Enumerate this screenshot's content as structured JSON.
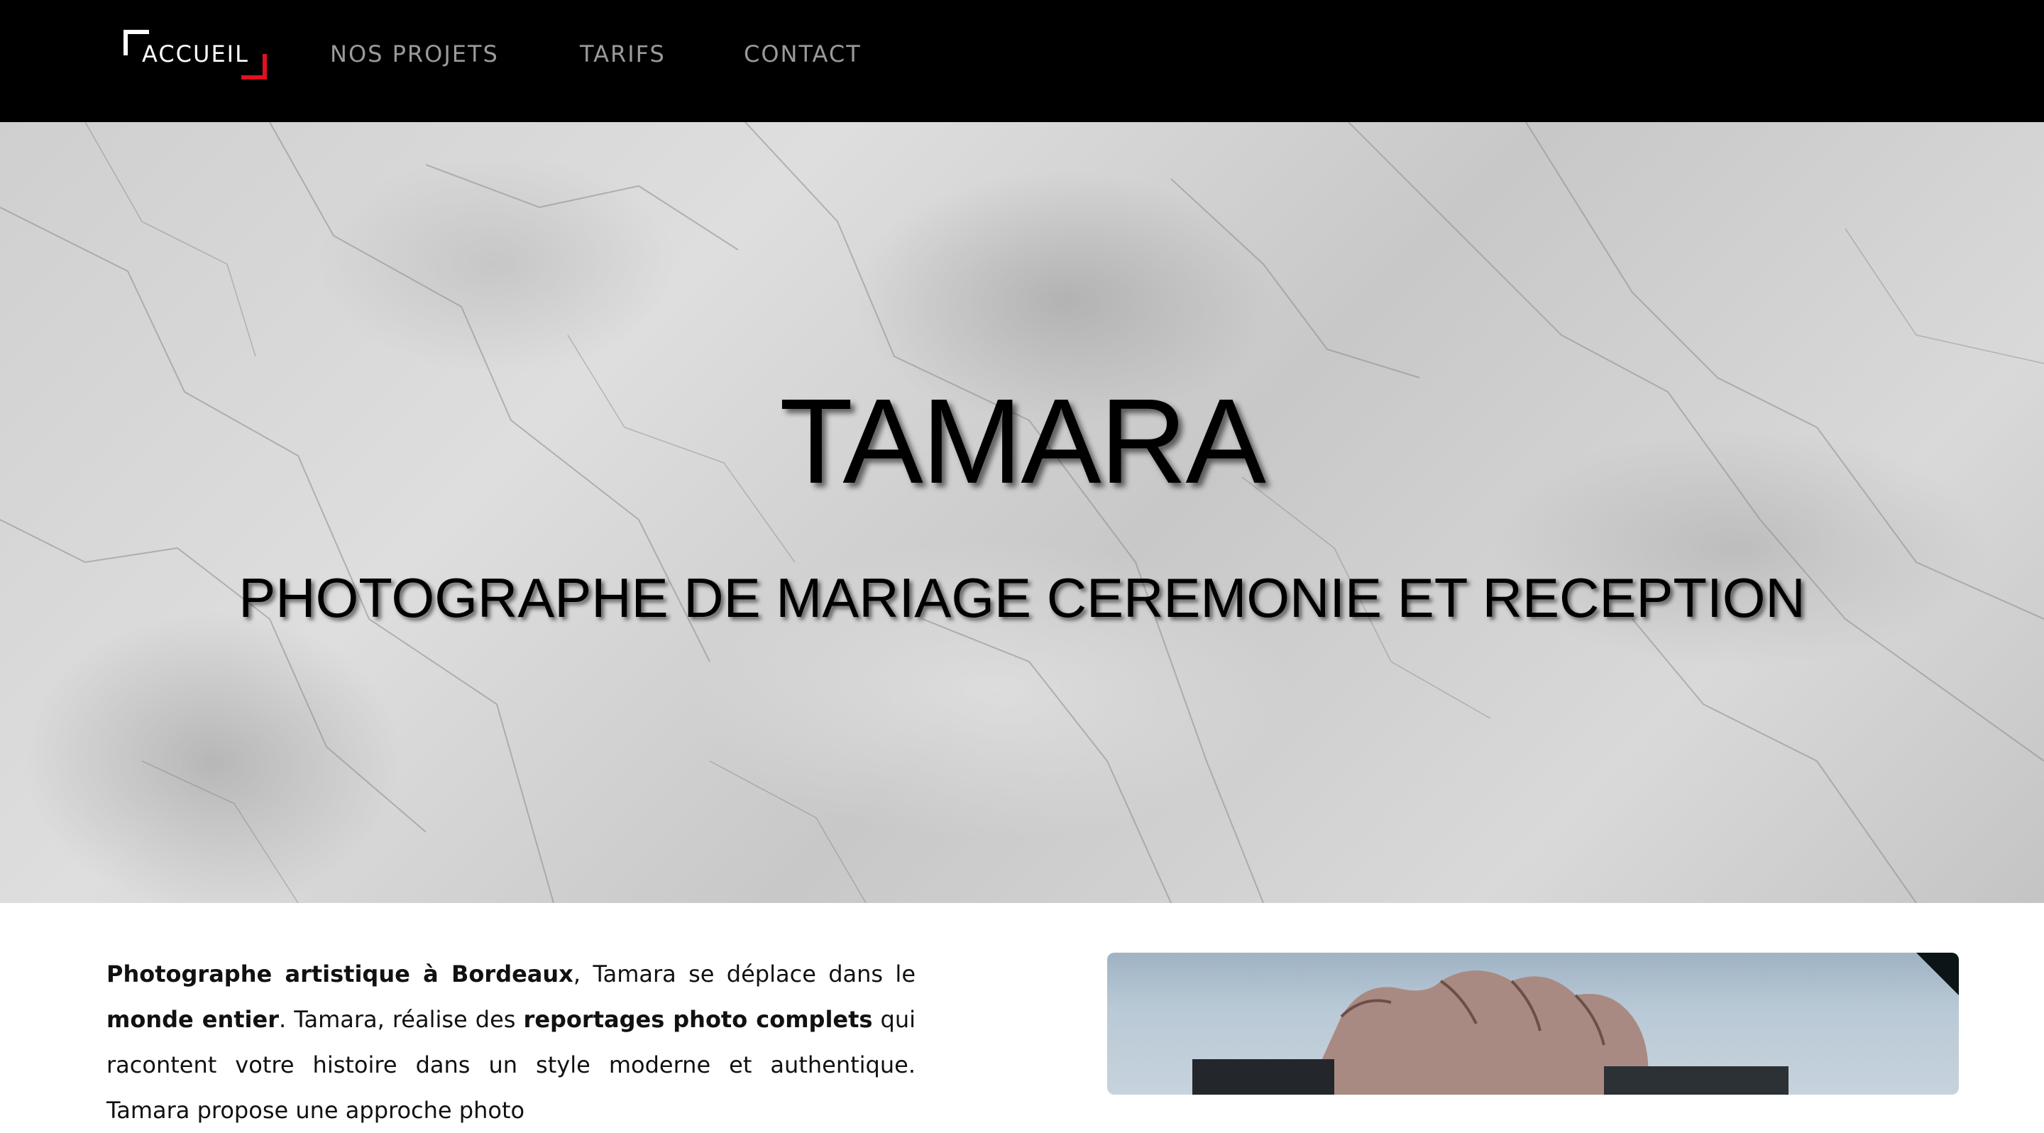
{
  "nav": {
    "items": [
      {
        "label": "ACCUEIL"
      },
      {
        "label": "NOS PROJETS"
      },
      {
        "label": "TARIFS"
      },
      {
        "label": "CONTACT"
      }
    ]
  },
  "hero": {
    "title": "TAMARA",
    "subtitle": "PHOTOGRAPHE DE MARIAGE CEREMONIE ET RECEPTION"
  },
  "intro": {
    "p1_bold": "Photographe artistique à Bordeaux",
    "p1_text1": ", Tamara se déplace dans le ",
    "p1_bold2": "monde entier",
    "p1_text2": ". Tamara, réalise des ",
    "p1_bold3": "reportages photo complets",
    "p1_text3": " qui racontent votre histoire dans un style moderne et authentique. Tamara propose une approche photo"
  },
  "colors": {
    "nav_bg": "#000000",
    "accent_red": "#e3101f",
    "nav_inactive": "#9a9a9a",
    "nav_active": "#ffffff"
  }
}
